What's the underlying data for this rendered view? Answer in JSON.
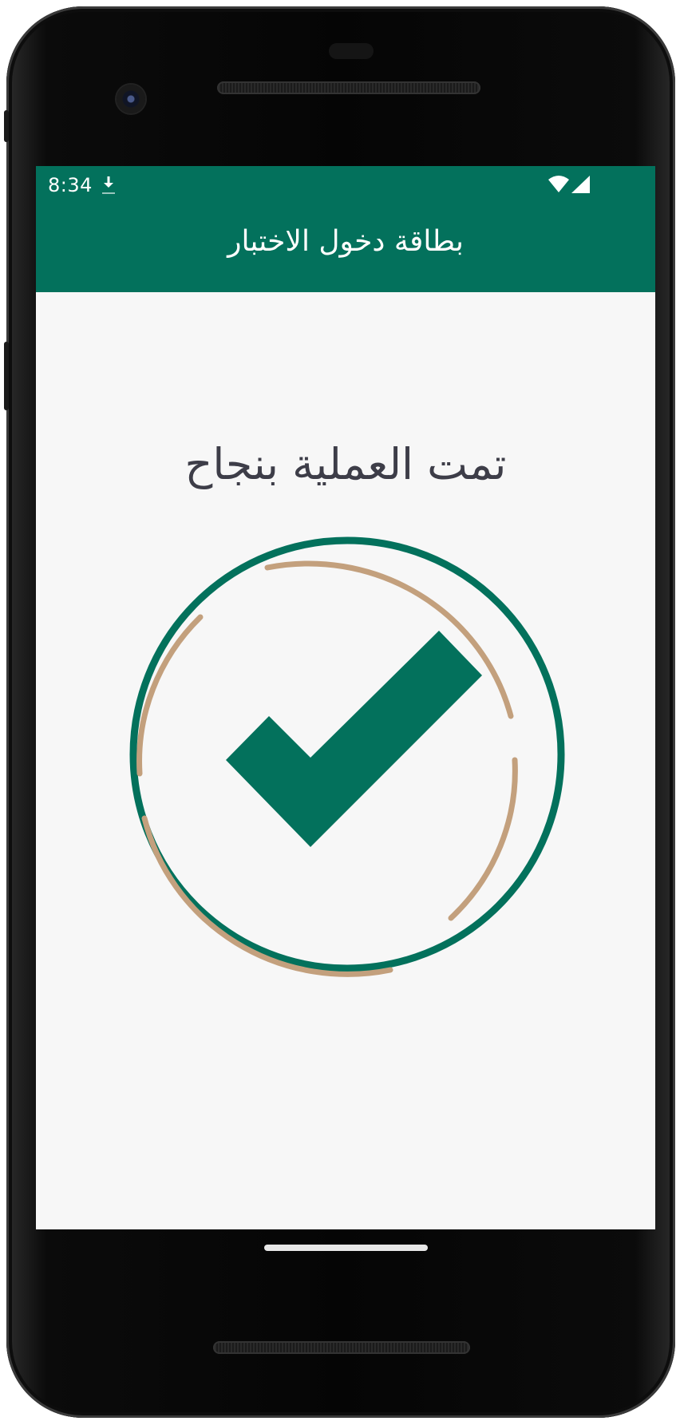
{
  "status_bar": {
    "time": "8:34",
    "download_icon": "download-icon",
    "wifi_icon": "wifi-icon",
    "signal_icon": "cellular-signal-icon"
  },
  "app_bar": {
    "title": "بطاقة دخول الاختبار"
  },
  "main": {
    "message": "تمت العملية بنجاح",
    "graphic_icon": "check-circle-icon"
  },
  "colors": {
    "primary": "#03715c",
    "accent": "#c3a07d",
    "background": "#f7f7f7",
    "text": "#3d3d48"
  }
}
